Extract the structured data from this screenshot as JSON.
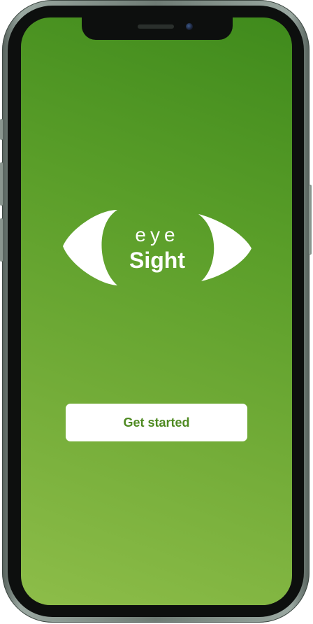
{
  "app": {
    "logo": {
      "line1": "eye",
      "line2": "Sight"
    },
    "get_started_label": "Get started"
  },
  "colors": {
    "background_top": "#3f8a1c",
    "background_bottom": "#8dbd49",
    "button_background": "#ffffff",
    "button_text": "#4f8a22",
    "logo": "#ffffff"
  },
  "icons": {
    "logo_left_shape": "left-crescent-icon",
    "logo_right_shape": "right-crescent-icon"
  }
}
